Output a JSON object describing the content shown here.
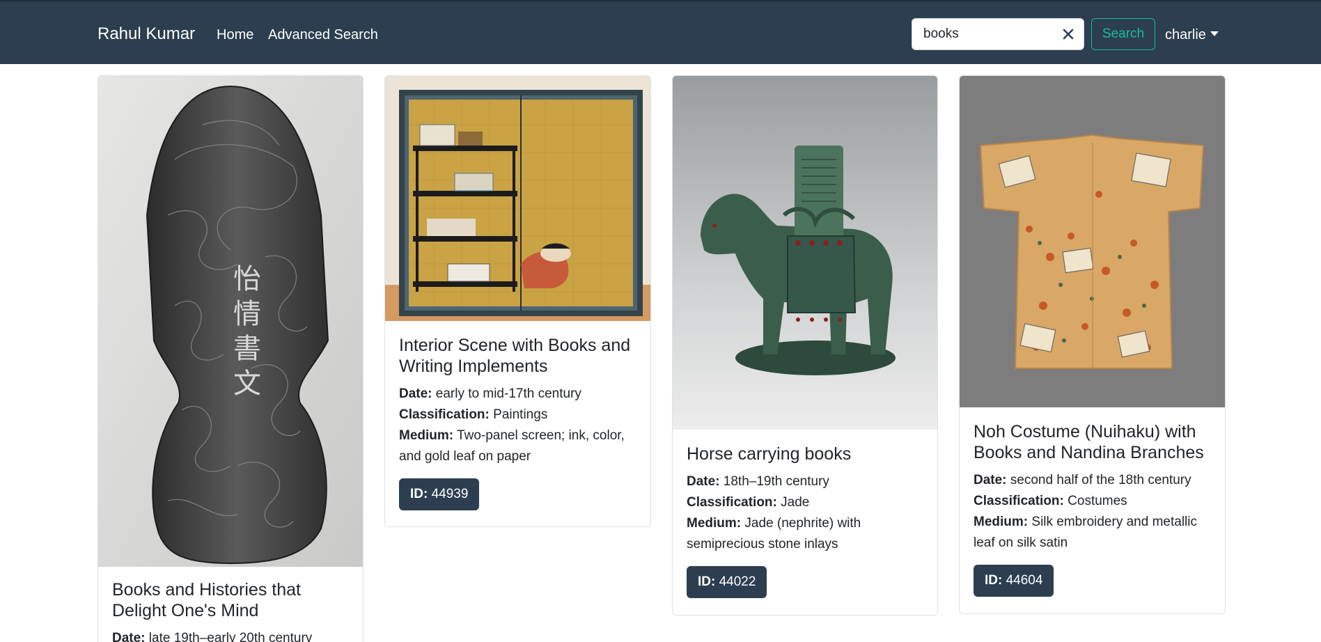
{
  "navbar": {
    "brand": "Rahul Kumar",
    "links": [
      "Home",
      "Advanced Search"
    ],
    "search_value": "books",
    "search_button": "Search",
    "user": "charlie"
  },
  "labels": {
    "date": "Date:",
    "classification": "Classification:",
    "medium": "Medium:",
    "id": "ID:"
  },
  "cards": [
    {
      "title": "Books and Histories that Delight One's Mind",
      "date": "late 19th–early 20th century",
      "image": "black-and-white photograph of carved ink stick with dragon and characters"
    },
    {
      "title": "Interior Scene with Books and Writing Implements",
      "date": "early to mid-17th century",
      "classification": "Paintings",
      "medium": "Two-panel screen; ink, color, and gold leaf on paper",
      "id": "44939",
      "image": "gold-leaf two-panel screen with bookshelf"
    },
    {
      "title": "Horse carrying books",
      "date": "18th–19th century",
      "classification": "Jade",
      "medium": "Jade (nephrite) with semiprecious stone inlays",
      "id": "44022",
      "image": "green jade horse sculpture carrying books"
    },
    {
      "title": "Noh Costume (Nuihaku) with Books and Nandina Branches",
      "date": "second half of the 18th century",
      "classification": "Costumes",
      "medium": "Silk embroidery and metallic leaf on silk satin",
      "id": "44604",
      "image": "embroidered gold kimono on grey background"
    }
  ]
}
